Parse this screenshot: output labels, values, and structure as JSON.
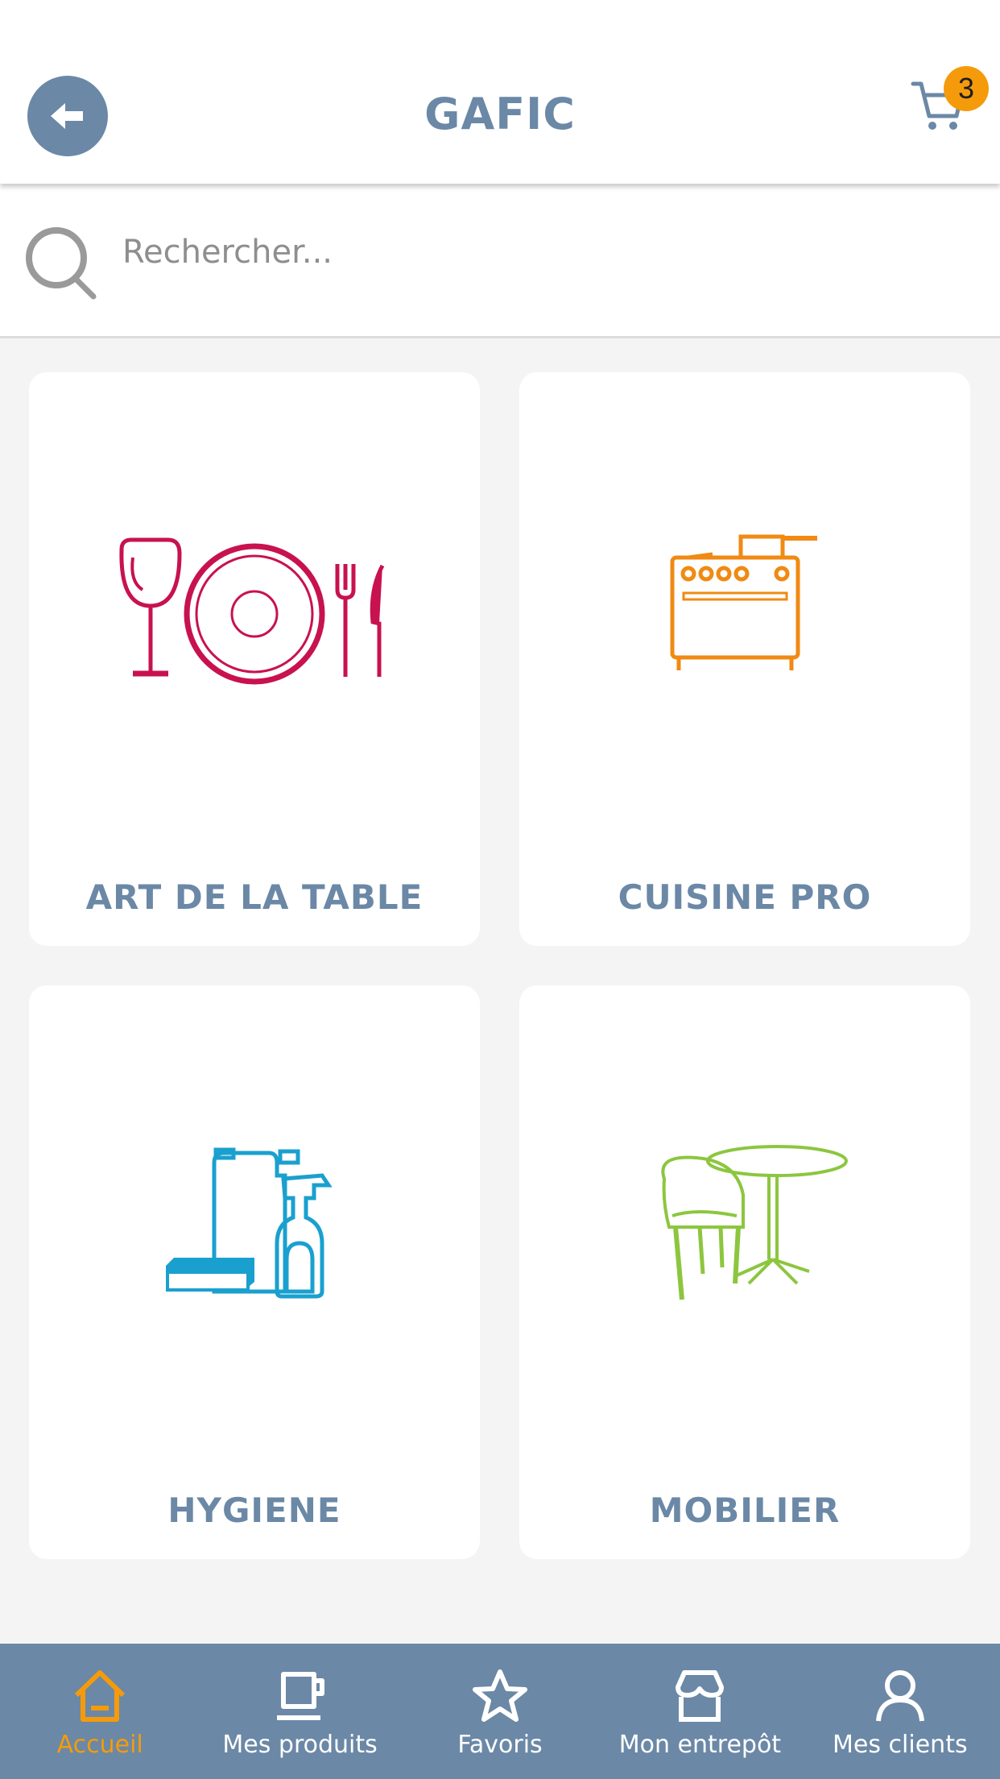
{
  "header": {
    "title": "GAFIC",
    "cart_count": "3"
  },
  "search": {
    "placeholder": "Rechercher..."
  },
  "categories": [
    {
      "label": "ART DE LA TABLE",
      "icon": "tableware-icon",
      "color": "#c8124f"
    },
    {
      "label": "CUISINE PRO",
      "icon": "oven-icon",
      "color": "#f08a13"
    },
    {
      "label": "HYGIENE",
      "icon": "cleaning-products-icon",
      "color": "#1aa0cf"
    },
    {
      "label": "MOBILIER",
      "icon": "table-chair-icon",
      "color": "#8cc63f"
    }
  ],
  "nav": [
    {
      "label": "Accueil",
      "icon": "home-icon",
      "active": true
    },
    {
      "label": "Mes produits",
      "icon": "cup-icon"
    },
    {
      "label": "Favoris",
      "icon": "star-icon"
    },
    {
      "label": "Mon entrepôt",
      "icon": "store-icon"
    },
    {
      "label": "Mes clients",
      "icon": "user-icon"
    }
  ],
  "colors": {
    "primary": "#6b88a6",
    "accent": "#f59b0b",
    "background": "#f4f4f4"
  }
}
